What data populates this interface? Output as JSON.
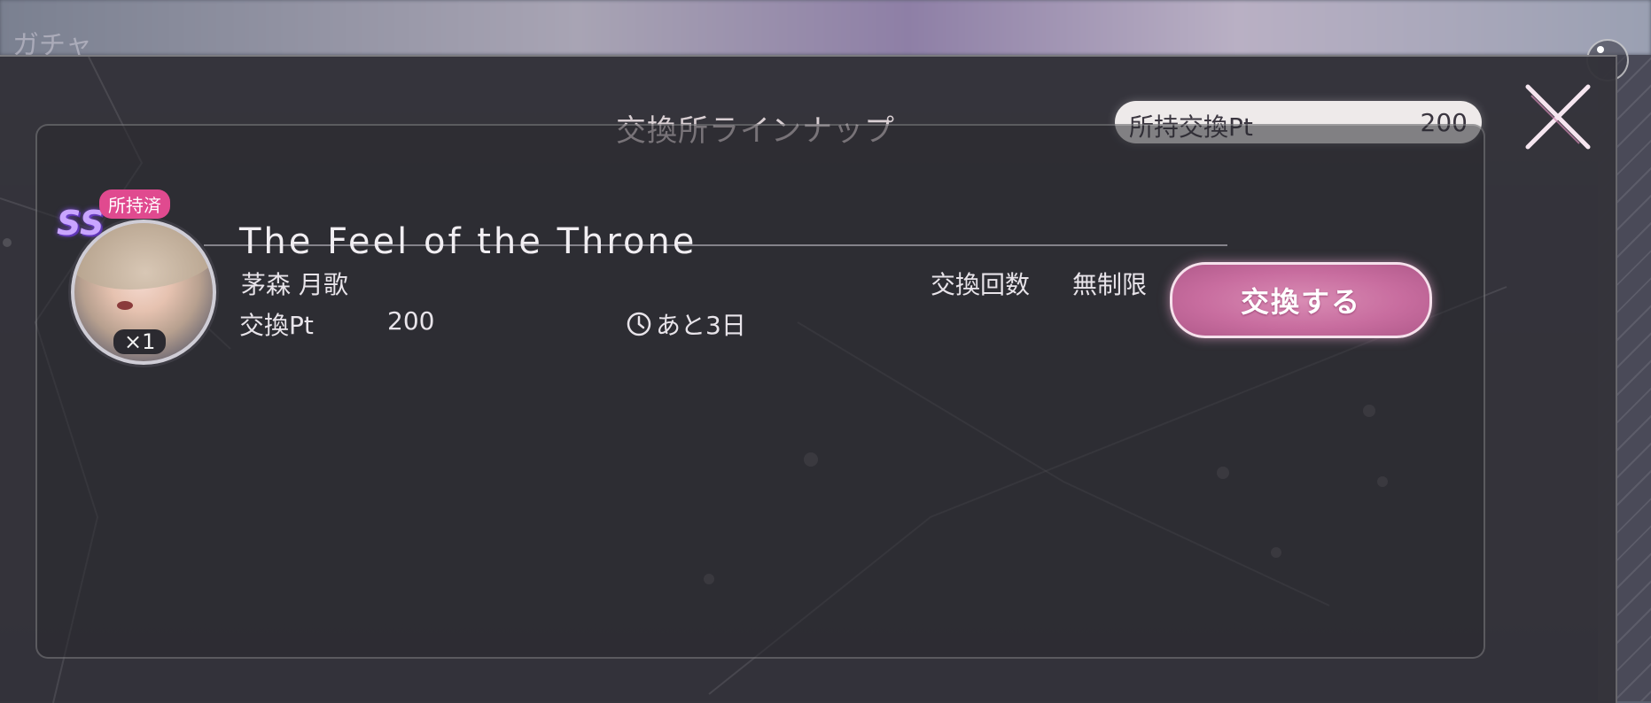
{
  "background": {
    "tab_label": "ガチャ"
  },
  "header": {
    "title": "交換所ラインナップ",
    "points_label": "所持交換Pt",
    "points_value": "200"
  },
  "items": [
    {
      "rarity": "SS",
      "owned_badge": "所持済",
      "quantity": "×1",
      "name": "The Feel of the Throne",
      "character": "茅森 月歌",
      "exchange_count_label": "交換回数",
      "exchange_count_value": "無制限",
      "cost_label": "交換Pt",
      "cost_value": "200",
      "time_remaining": "あと3日",
      "button_label": "交換する"
    }
  ],
  "colors": {
    "accent_pink": "#c86d9f",
    "badge_pink": "#e04a8f",
    "rarity_purple": "#c9a5ff"
  }
}
